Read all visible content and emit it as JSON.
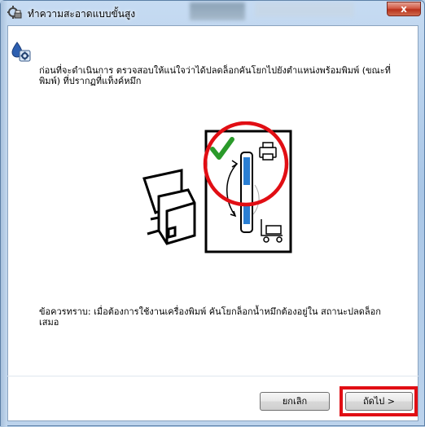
{
  "window": {
    "title": "ทำความสะอาดแบบขั้นสูง",
    "close_label": "x"
  },
  "content": {
    "instruction": "ก่อนที่จะดำเนินการ ตรวจสอบให้แน่ใจว่าได้ปลดล็อกคันโยกไปยังตำแหน่งพร้อมพิมพ์ (ขณะที่พิมพ์) ที่ปรากฏที่แท็งค์หมึก",
    "note": "ข้อควรทราบ: เมื่อต้องการใช้งานเครื่องพิมพ์ คันโยกล็อกน้ำหมึกต้องอยู่ใน สถานะปลดล็อกเสมอ"
  },
  "buttons": {
    "cancel": "ยกเลิก",
    "next": "ถัดไป >"
  },
  "icons": {
    "title": "printer-cleaning-icon",
    "info": "ink-settings-icon",
    "check": "checkmark-icon",
    "printer": "printer-icon",
    "transport": "transport-cart-icon"
  },
  "colors": {
    "highlight": "#e10e14",
    "check": "#2a9a2a"
  }
}
